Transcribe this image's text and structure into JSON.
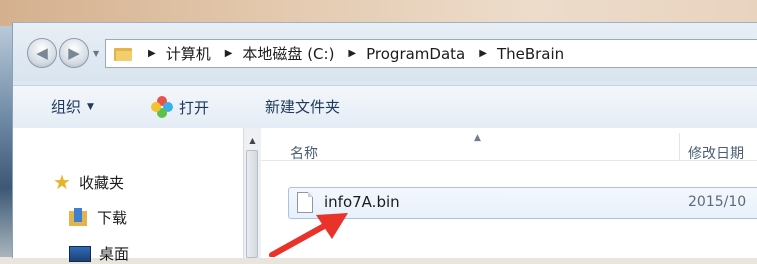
{
  "window": {
    "breadcrumbs": [
      "计算机",
      "本地磁盘 (C:)",
      "ProgramData",
      "TheBrain"
    ]
  },
  "toolbar": {
    "organize_label": "组织",
    "open_label": "打开",
    "new_folder_label": "新建文件夹"
  },
  "nav_pane": {
    "favorites_label": "收藏夹",
    "downloads_label": "下载",
    "desktop_label": "桌面"
  },
  "file_list": {
    "columns": {
      "name": "名称",
      "date_modified": "修改日期"
    },
    "files": [
      {
        "name": "info7A.bin",
        "date_modified": "2015/10"
      }
    ]
  },
  "annotation": {
    "arrow_color": "#e8322a"
  },
  "icons": {
    "back": "back-arrow-icon",
    "forward": "forward-arrow-icon",
    "folder": "folder-icon",
    "open": "pinwheel-icon",
    "favorites": "star-icon",
    "downloads": "downloads-folder-icon",
    "desktop": "desktop-icon",
    "file": "file-icon"
  }
}
